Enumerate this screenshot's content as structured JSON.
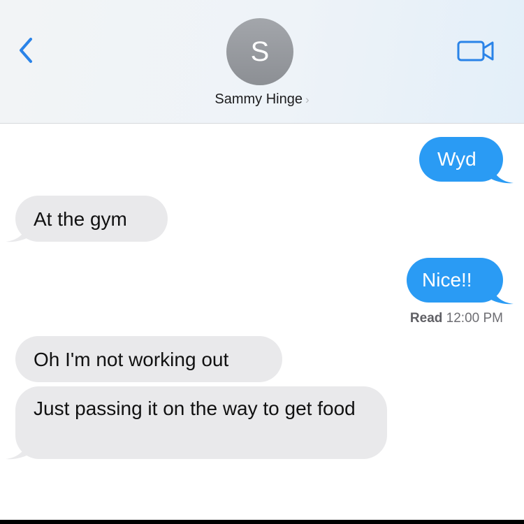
{
  "header": {
    "back_icon": "chevron-left-icon",
    "avatar_initial": "S",
    "contact_name": "Sammy Hinge",
    "contact_chevron": "›",
    "video_icon": "video-camera-icon",
    "accent_color": "#2a9bf4"
  },
  "messages": [
    {
      "direction": "outgoing",
      "text": "Wyd"
    },
    {
      "direction": "incoming",
      "text": "At the gym"
    },
    {
      "direction": "outgoing",
      "text": "Nice!!"
    },
    {
      "direction": "incoming",
      "text": "Oh I'm not working out"
    },
    {
      "direction": "incoming",
      "text": "Just passing it on the way to get food"
    }
  ],
  "read_receipt": {
    "label": "Read",
    "time": "12:00 PM"
  },
  "colors": {
    "outgoing_bubble": "#2a9bf4",
    "incoming_bubble": "#e9e9eb"
  }
}
